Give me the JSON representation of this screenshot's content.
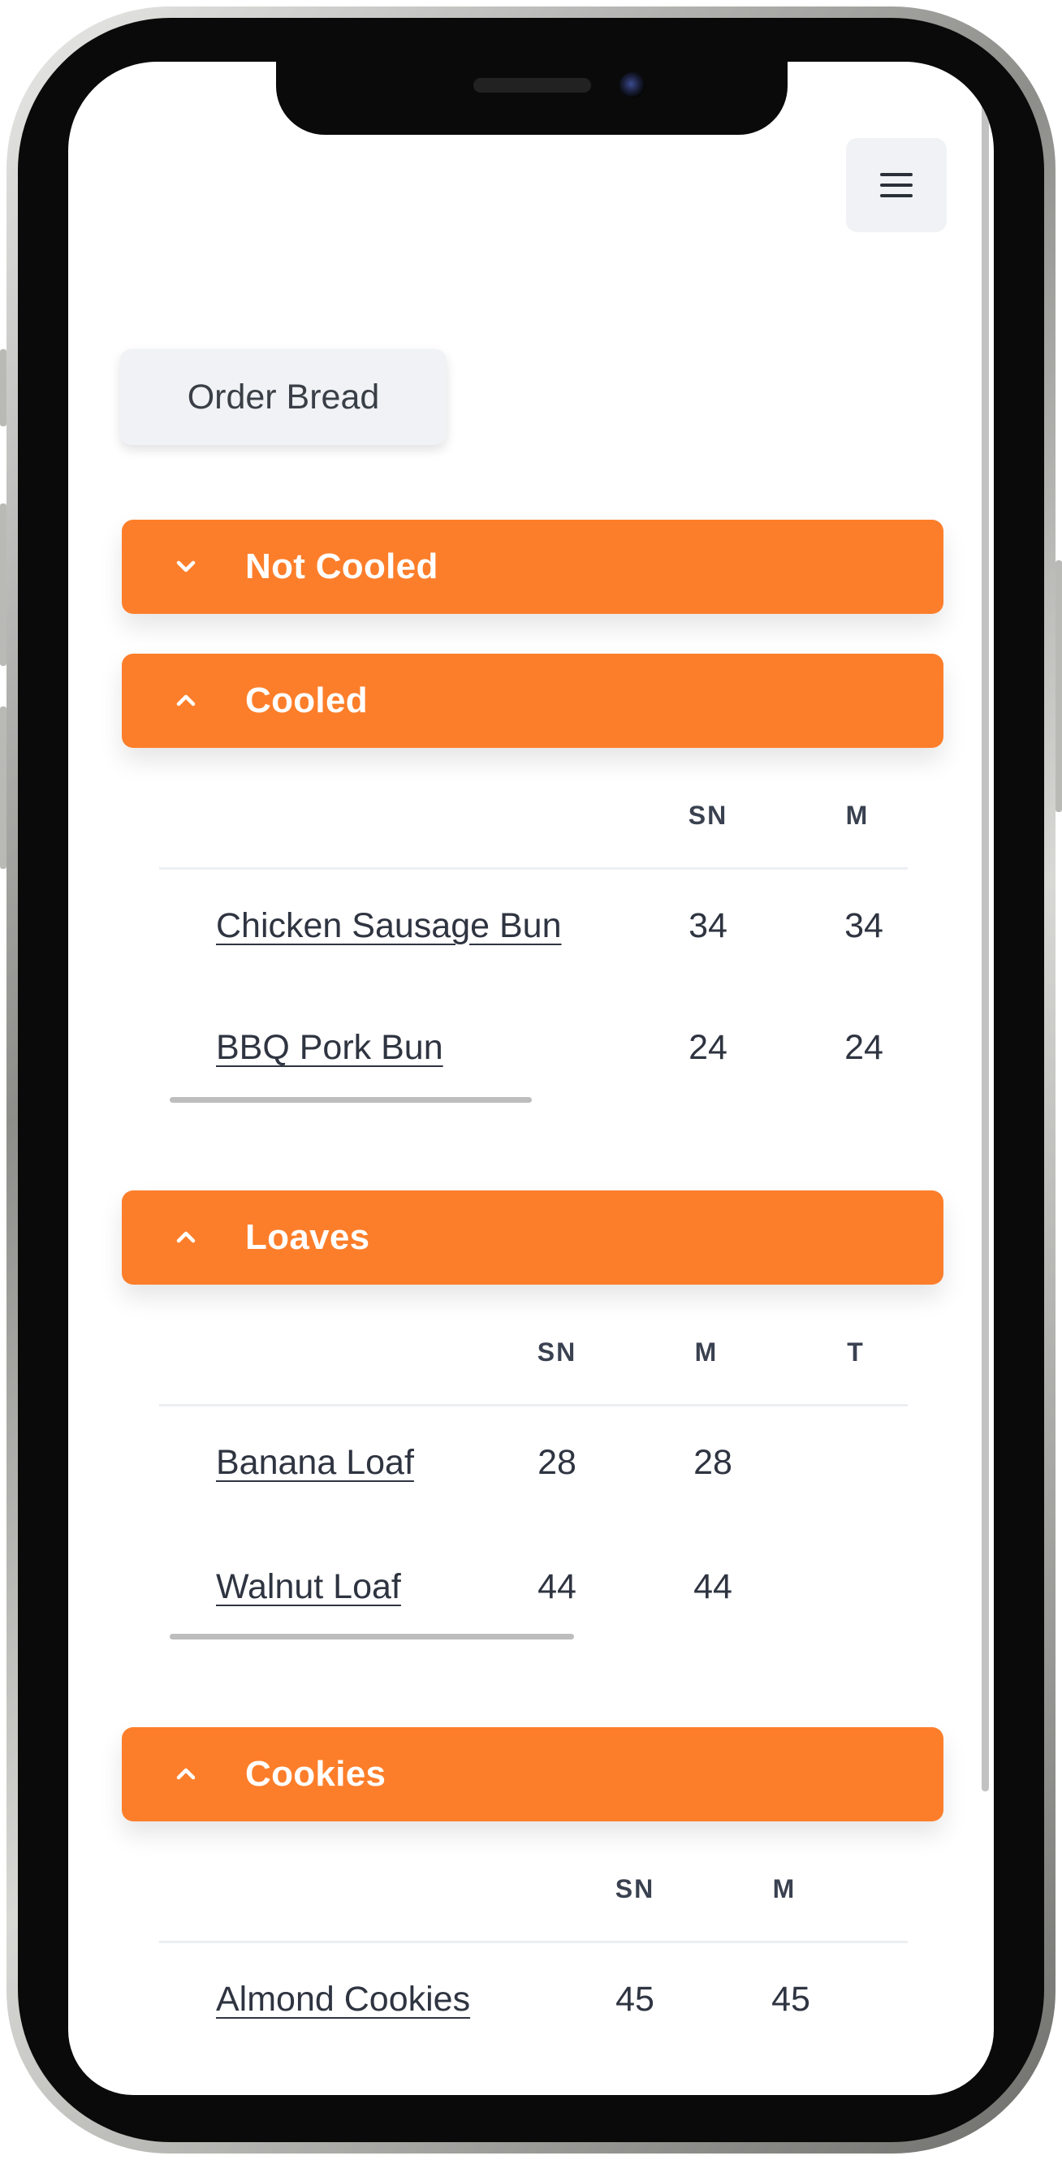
{
  "app": {
    "order_button_label": "Order Bread",
    "menu_icon": "hamburger-menu-icon",
    "accent_color": "#fd7e2a"
  },
  "sections": [
    {
      "title": "Not Cooled",
      "expanded": false,
      "icon": "chevron-down-icon"
    },
    {
      "title": "Cooled",
      "expanded": true,
      "icon": "chevron-up-icon",
      "columns": [
        "SN",
        "M"
      ],
      "rows": [
        {
          "name": "Chicken Sausage Bun",
          "values": [
            "34",
            "34"
          ]
        },
        {
          "name": "BBQ Pork Bun",
          "values": [
            "24",
            "24"
          ]
        }
      ]
    },
    {
      "title": "Loaves",
      "expanded": true,
      "icon": "chevron-up-icon",
      "columns": [
        "SN",
        "M",
        "T"
      ],
      "rows": [
        {
          "name": "Banana Loaf",
          "values": [
            "28",
            "28",
            ""
          ]
        },
        {
          "name": "Walnut Loaf",
          "values": [
            "44",
            "44",
            ""
          ]
        }
      ]
    },
    {
      "title": "Cookies",
      "expanded": true,
      "icon": "chevron-up-icon",
      "columns": [
        "SN",
        "M"
      ],
      "rows": [
        {
          "name": "Almond Cookies",
          "values": [
            "45",
            "45"
          ]
        }
      ]
    }
  ]
}
